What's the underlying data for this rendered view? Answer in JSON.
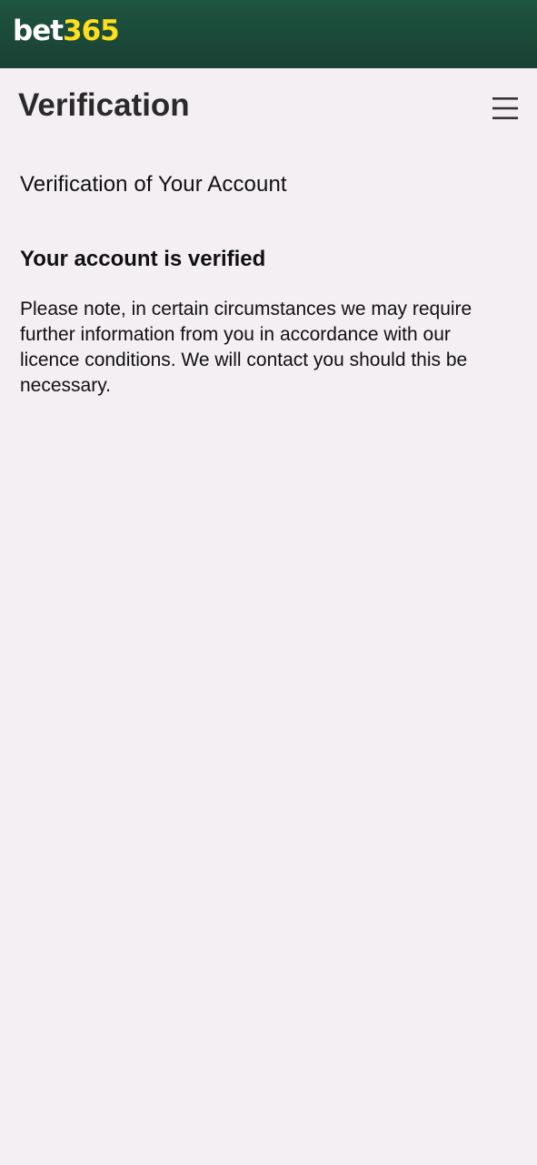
{
  "app_bar": {
    "logo": {
      "bet": "bet",
      "num": "365"
    },
    "background": "#1e5541",
    "logo_accent": "#ffdf1b"
  },
  "header": {
    "title": "Verification",
    "menu_icon": "hamburger-menu-icon"
  },
  "content": {
    "section_title": "Verification of Your Account",
    "status_heading": "Your account is verified",
    "note": "Please note, in certain circumstances we may require further information from you in accordance with our licence conditions. We will contact you should this be necessary."
  }
}
